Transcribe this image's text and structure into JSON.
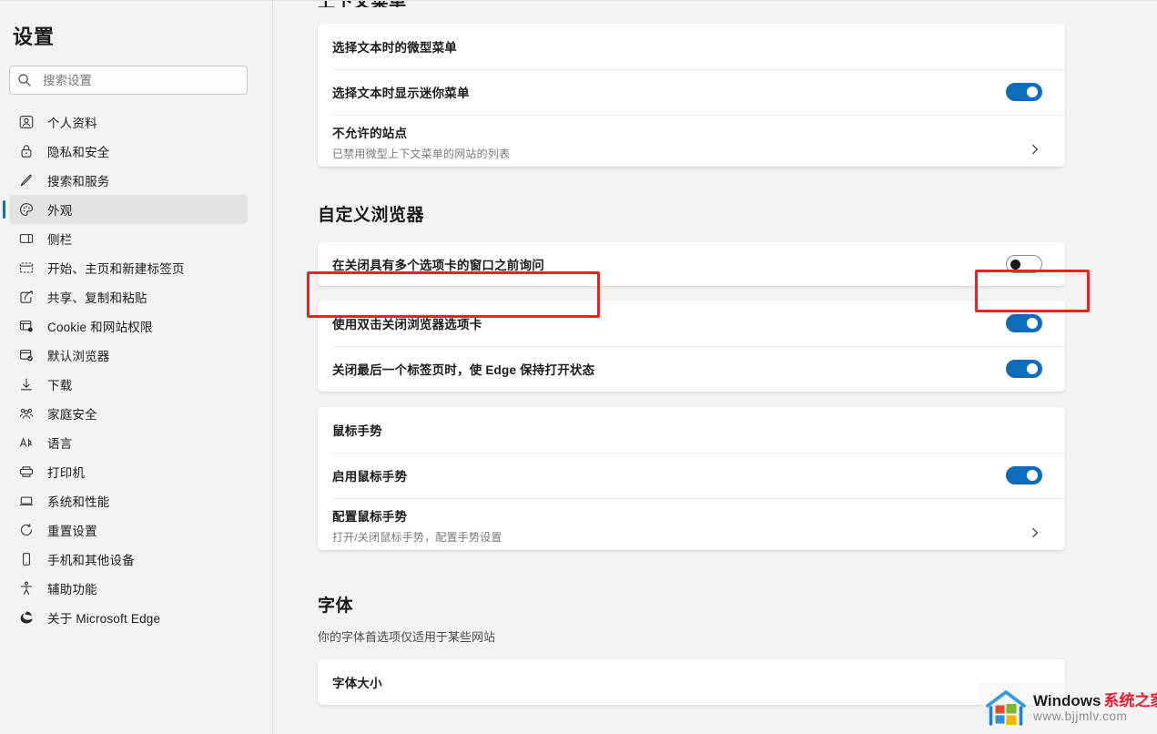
{
  "window": {
    "title": "设置"
  },
  "sidebar": {
    "title": "设置",
    "search": {
      "placeholder": "搜索设置",
      "value": "",
      "icon": "search-icon"
    },
    "items": [
      {
        "label": "个人资料",
        "icon": "person-profile-icon",
        "active": false
      },
      {
        "label": "隐私和安全",
        "icon": "lock-shield-icon",
        "active": false
      },
      {
        "label": "搜索和服务",
        "icon": "pencil-icon",
        "active": false
      },
      {
        "label": "外观",
        "icon": "palette-icon",
        "active": true
      },
      {
        "label": "侧栏",
        "icon": "sidebar-panel-icon",
        "active": false
      },
      {
        "label": "开始、主页和新建标签页",
        "icon": "browser-window-icon",
        "active": false
      },
      {
        "label": "共享、复制和粘贴",
        "icon": "share-arrow-icon",
        "active": false
      },
      {
        "label": "Cookie 和网站权限",
        "icon": "cookie-gear-icon",
        "active": false
      },
      {
        "label": "默认浏览器",
        "icon": "browser-check-icon",
        "active": false
      },
      {
        "label": "下载",
        "icon": "download-arrow-icon",
        "active": false
      },
      {
        "label": "家庭安全",
        "icon": "family-people-icon",
        "active": false
      },
      {
        "label": "语言",
        "icon": "language-letters-icon",
        "active": false
      },
      {
        "label": "打印机",
        "icon": "printer-icon",
        "active": false
      },
      {
        "label": "系统和性能",
        "icon": "laptop-icon",
        "active": false
      },
      {
        "label": "重置设置",
        "icon": "reset-arrow-icon",
        "active": false
      },
      {
        "label": "手机和其他设备",
        "icon": "phone-icon",
        "active": false
      },
      {
        "label": "辅助功能",
        "icon": "accessibility-icon",
        "active": false
      },
      {
        "label": "关于 Microsoft Edge",
        "icon": "edge-logo-icon",
        "active": false
      }
    ]
  },
  "main": {
    "sections": [
      {
        "heading": "上下文菜单",
        "clipped": true,
        "cards": [
          {
            "rows": [
              {
                "title": "选择文本时的微型菜单",
                "control": "none"
              },
              {
                "title": "选择文本时显示迷你菜单",
                "control": "toggle",
                "toggle_on": true
              },
              {
                "title": "不允许的站点",
                "desc": "已禁用微型上下文菜单的网站的列表",
                "control": "chevron"
              }
            ]
          }
        ]
      },
      {
        "heading": "自定义浏览器",
        "clipped": false,
        "cards": [
          {
            "highlighted": true,
            "rows": [
              {
                "title": "在关闭具有多个选项卡的窗口之前询问",
                "control": "toggle",
                "toggle_on": false
              }
            ]
          },
          {
            "rows": [
              {
                "title": "使用双击关闭浏览器选项卡",
                "control": "toggle",
                "toggle_on": true
              },
              {
                "title": "关闭最后一个标签页时，使 Edge 保持打开状态",
                "control": "toggle",
                "toggle_on": true
              }
            ]
          },
          {
            "rows": [
              {
                "title": "鼠标手势",
                "control": "none"
              },
              {
                "title": "启用鼠标手势",
                "control": "toggle",
                "toggle_on": true
              },
              {
                "title": "配置鼠标手势",
                "desc": "打开/关闭鼠标手势，配置手势设置",
                "control": "chevron"
              }
            ]
          }
        ]
      },
      {
        "heading": "字体",
        "clipped": false,
        "sub": "你的字体首选项仅适用于某些网站",
        "cards": [
          {
            "rows": [
              {
                "title": "字体大小",
                "control": "none"
              }
            ]
          }
        ]
      }
    ]
  },
  "annotations": {
    "color": "#ee2020",
    "boxes": [
      {
        "name": "highlight-ask-before-closing-label"
      },
      {
        "name": "highlight-ask-before-closing-toggle"
      }
    ]
  },
  "watermark": {
    "brand_en": "Windows",
    "brand_cn": "系统之家",
    "url": "www.bjjmlv.com",
    "logo_icon": "windows-house-logo-icon",
    "cn_color": "#e8192c"
  },
  "theme": {
    "accent": "#0f6cbd",
    "page_bg": "#f3f3f3",
    "card_bg": "#ffffff",
    "active_nav_bg": "#e3e3e3",
    "text": "#1b1b1b",
    "muted_text": "#787878"
  }
}
